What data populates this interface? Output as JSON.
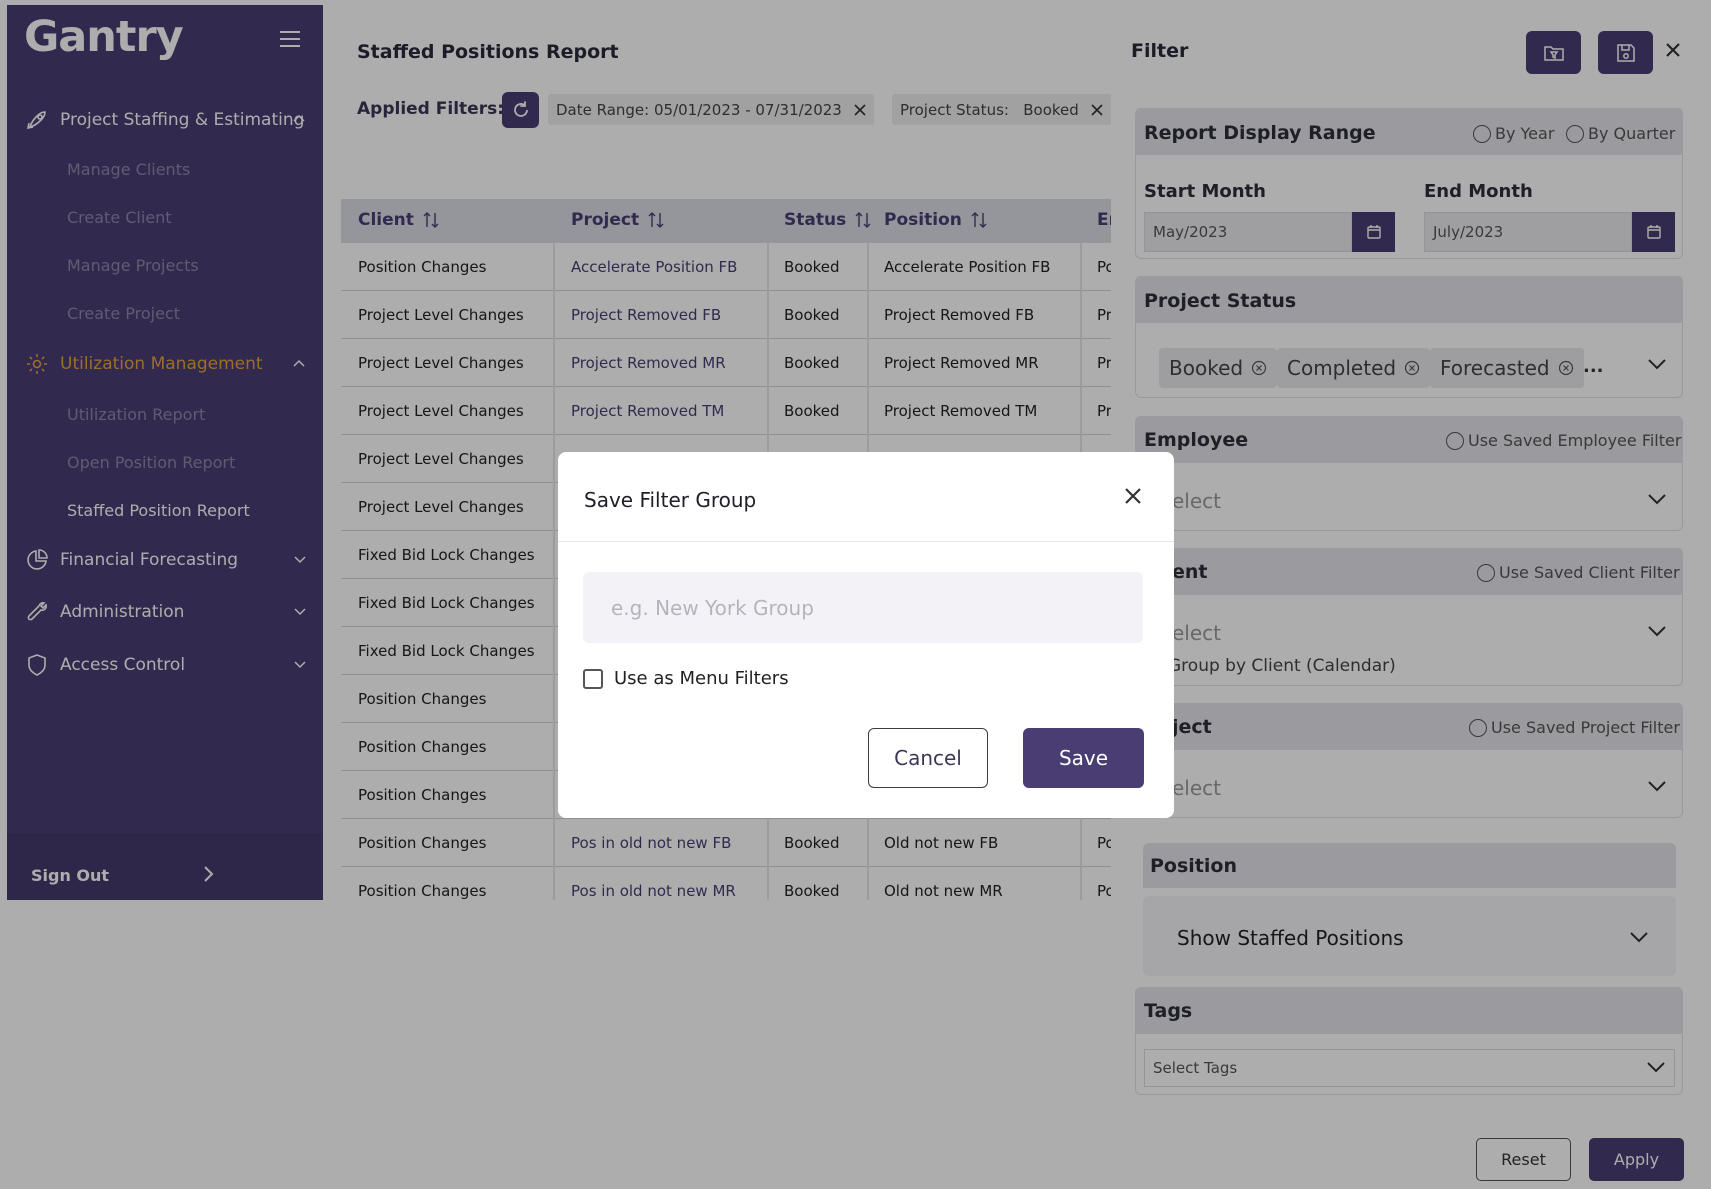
{
  "app": {
    "logo_text": "Gantry"
  },
  "sidebar": {
    "sections": [
      {
        "label": "Project Staffing & Estimating",
        "icon": "rocket-icon"
      },
      {
        "label": "Utilization Management",
        "icon": "gear-icon"
      },
      {
        "label": "Financial Forecasting",
        "icon": "pie-chart-icon"
      },
      {
        "label": "Administration",
        "icon": "wrench-icon"
      },
      {
        "label": "Access Control",
        "icon": "shield-icon"
      }
    ],
    "sub_items": [
      "Manage Clients",
      "Create Client",
      "Manage Projects",
      "Create Project",
      "Utilization Report",
      "Open Position Report",
      "Staffed Position Report"
    ],
    "sign_out": "Sign Out",
    "colors": {
      "accent": "#4a3d73",
      "highlight": "#e6a23c"
    }
  },
  "report": {
    "title": "Staffed Positions Report",
    "applied_filters_label": "Applied Filters:",
    "chips": [
      "Date Range: 05/01/2023 - 07/31/2023",
      "Project Status:   Booked"
    ],
    "columns": [
      "Client",
      "Project",
      "Status",
      "Position",
      "En"
    ],
    "rows": [
      {
        "client": "Position Changes",
        "project": "Accelerate Position FB",
        "status": "Booked",
        "position": "Accelerate Position FB",
        "e": "Po"
      },
      {
        "client": "Project Level Changes",
        "project": "Project Removed FB",
        "status": "Booked",
        "position": "Project Removed FB",
        "e": "Pr"
      },
      {
        "client": "Project Level Changes",
        "project": "Project Removed MR",
        "status": "Booked",
        "position": "Project Removed MR",
        "e": "Pr"
      },
      {
        "client": "Project Level Changes",
        "project": "Project Removed TM",
        "status": "Booked",
        "position": "Project Removed TM",
        "e": "Pr"
      },
      {
        "client": "Project Level Changes",
        "project": "",
        "status": "",
        "position": "",
        "e": ""
      },
      {
        "client": "Project Level Changes",
        "project": "",
        "status": "",
        "position": "",
        "e": ""
      },
      {
        "client": "Fixed Bid Lock Changes",
        "project": "",
        "status": "",
        "position": "",
        "e": ""
      },
      {
        "client": "Fixed Bid Lock Changes",
        "project": "",
        "status": "",
        "position": "",
        "e": ""
      },
      {
        "client": "Fixed Bid Lock Changes",
        "project": "",
        "status": "",
        "position": "",
        "e": ""
      },
      {
        "client": "Position Changes",
        "project": "",
        "status": "",
        "position": "",
        "e": ""
      },
      {
        "client": "Position Changes",
        "project": "",
        "status": "",
        "position": "",
        "e": ""
      },
      {
        "client": "Position Changes",
        "project": "",
        "status": "",
        "position": "",
        "e": ""
      },
      {
        "client": "Position Changes",
        "project": "Pos in old not new FB",
        "status": "Booked",
        "position": "Old not new FB",
        "e": "Po"
      },
      {
        "client": "Position Changes",
        "project": "Pos in old not new MR",
        "status": "Booked",
        "position": "Old not new MR",
        "e": "Po"
      }
    ]
  },
  "filter": {
    "title": "Filter",
    "display_range": {
      "title": "Report Display Range",
      "by_year": "By Year",
      "by_quarter": "By Quarter",
      "start_label": "Start Month",
      "start_value": "May/2023",
      "end_label": "End Month",
      "end_value": "July/2023"
    },
    "project_status": {
      "title": "Project Status",
      "tags": [
        "Booked",
        "Completed",
        "Forecasted"
      ],
      "more": "..."
    },
    "employee": {
      "title": "Employee",
      "saved": "Use Saved Employee Filter",
      "placeholder": "elect"
    },
    "client": {
      "title": "ent",
      "saved": "Use Saved Client Filter",
      "placeholder": "elect",
      "group_by": "Group by Client (Calendar)"
    },
    "project": {
      "title": "ject",
      "saved": "Use Saved Project Filter",
      "placeholder": "elect"
    },
    "position": {
      "title": "Position",
      "value": "Show Staffed Positions"
    },
    "tags": {
      "title": "Tags",
      "placeholder": "Select Tags"
    },
    "reset": "Reset",
    "apply": "Apply"
  },
  "modal": {
    "title": "Save Filter Group",
    "input_placeholder": "e.g. New York Group",
    "input_value": "",
    "checkbox_label": "Use as Menu Filters",
    "cancel": "Cancel",
    "save": "Save"
  }
}
